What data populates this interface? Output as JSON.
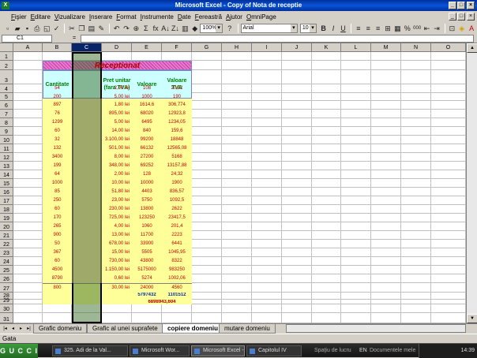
{
  "window": {
    "title": "Microsoft Excel - Copy of Nota de receptie",
    "controls": [
      "_",
      "□",
      "×"
    ],
    "doc_controls": [
      "_",
      "□",
      "×"
    ]
  },
  "menu": [
    "Fişier",
    "Editare",
    "Vizualizare",
    "Inserare",
    "Format",
    "Instrumente",
    "Date",
    "Fereastră",
    "Ajutor",
    "OmniPage"
  ],
  "toolbar": {
    "font": "Arial",
    "size": "10",
    "zoom": "100%",
    "bold": "B",
    "italic": "I",
    "underline": "U",
    "percent": "%",
    "thousands": "000",
    "sigma": "Σ",
    "fx_btn": "fx",
    "sort_asc": "A↓",
    "sort_desc": "Z↓"
  },
  "namebox": "C1",
  "fx_label": "=",
  "fx_value": "",
  "columns": [
    "A",
    "B",
    "C",
    "D",
    "E",
    "F",
    "G",
    "H",
    "I",
    "J",
    "K",
    "L",
    "M",
    "N",
    "O"
  ],
  "row_numbers": [
    "1",
    "2",
    "3",
    "4",
    "5",
    "6",
    "7",
    "8",
    "9",
    "10",
    "11",
    "12",
    "13",
    "14",
    "15",
    "16",
    "17",
    "18",
    "19",
    "20",
    "21",
    "22",
    "23",
    "24",
    "25",
    "26",
    "27",
    "28",
    "29",
    "30",
    "31"
  ],
  "table": {
    "title": "Receptionat",
    "headers": {
      "cantitate": "Cantitate",
      "pret": "Pret unitar(fara TVA)",
      "valoare": "Valoare",
      "valoare_tva": "Valoare TVA"
    },
    "rows": [
      [
        "54",
        "2,00 lei",
        "108",
        "20,52"
      ],
      [
        "200",
        "5,00 lei",
        "1000",
        "190"
      ],
      [
        "897",
        "1,80 lei",
        "1614,6",
        "306,774"
      ],
      [
        "76",
        "895,00 lei",
        "68020",
        "12923,8"
      ],
      [
        "1299",
        "5,00 lei",
        "6495",
        "1234,05"
      ],
      [
        "60",
        "14,00 lei",
        "840",
        "159,6"
      ],
      [
        "32",
        "3.100,00 lei",
        "99200",
        "18848"
      ],
      [
        "132",
        "501,00 lei",
        "66132",
        "12565,08"
      ],
      [
        "3400",
        "8,00 lei",
        "27200",
        "5168"
      ],
      [
        "199",
        "348,00 lei",
        "69252",
        "13157,88"
      ],
      [
        "64",
        "2,00 lei",
        "128",
        "24,32"
      ],
      [
        "1000",
        "10,00 lei",
        "10000",
        "1900"
      ],
      [
        "85",
        "51,80 lei",
        "4403",
        "836,57"
      ],
      [
        "250",
        "23,00 lei",
        "5750",
        "1092,5"
      ],
      [
        "60",
        "230,00 lei",
        "13800",
        "2622"
      ],
      [
        "170",
        "725,00 lei",
        "123250",
        "23417,5"
      ],
      [
        "265",
        "4,00 lei",
        "1060",
        "201,4"
      ],
      [
        "900",
        "13,00 lei",
        "11700",
        "2223"
      ],
      [
        "50",
        "678,00 lei",
        "33900",
        "6441"
      ],
      [
        "367",
        "15,00 lei",
        "5505",
        "1045,95"
      ],
      [
        "60",
        "730,00 lei",
        "43800",
        "8322"
      ],
      [
        "4500",
        "1.150,00 lei",
        "5175000",
        "983250"
      ],
      [
        "8790",
        "0,60 lei",
        "5274",
        "1002,06"
      ],
      [
        "800",
        "30,00 lei",
        "24000",
        "4560"
      ]
    ],
    "total_valoare": "5797432",
    "total_tva": "1101512",
    "grand_total": "6898943,604"
  },
  "sheets": {
    "nav": [
      "|◂",
      "◂",
      "▸",
      "▸|"
    ],
    "tabs": [
      "Grafic domeniu",
      "Grafic al unei suprafete",
      "copiere domeniu",
      "mutare domeniu"
    ],
    "active_index": 2
  },
  "status": "Gata",
  "taskbar": {
    "start": "G U C C I",
    "tasks": [
      "325. Adi de la Val...",
      "Microsoft Wor...",
      "Microsoft Excel -...",
      "Capitolul IV"
    ],
    "tray_items": [
      "Spaţiu de lucru",
      "EN",
      "Documentele mele"
    ],
    "clock": "14:39"
  }
}
